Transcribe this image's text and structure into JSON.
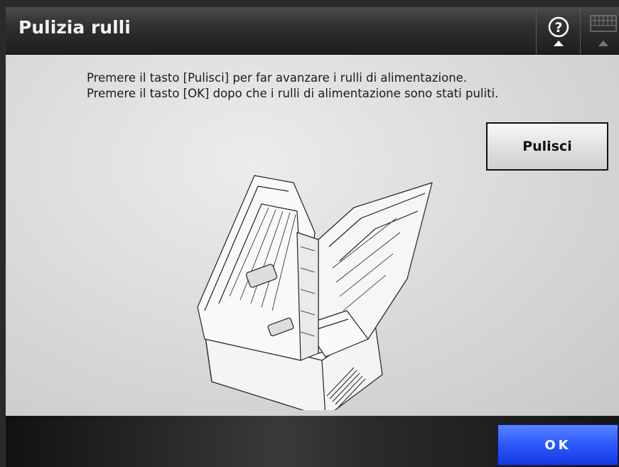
{
  "window": {
    "title": "Pulizia rulli"
  },
  "toolbar": {
    "help_icon": "help-icon",
    "keyboard_icon": "keyboard-icon"
  },
  "main": {
    "instruction_line1": "Premere il tasto [Pulisci] per far avanzare i rulli di alimentazione.",
    "instruction_line2": "Premere il tasto [OK] dopo che i rulli di alimentazione sono stati puliti.",
    "clean_button_label": "Pulisci",
    "illustration": "scanner-illustration"
  },
  "footer": {
    "ok_label": "OK"
  },
  "colors": {
    "ok_button": "#2f5cff",
    "titlebar": "#2e2e2e"
  }
}
